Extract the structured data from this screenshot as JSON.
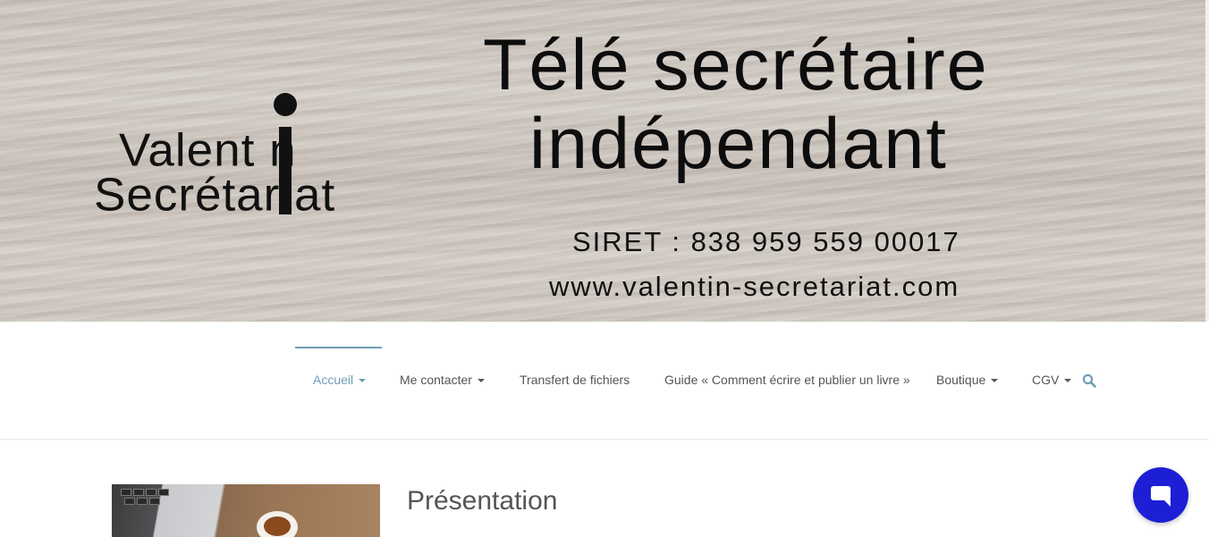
{
  "banner": {
    "logo_line1": "Valent n",
    "logo_line2": "Secrétar at",
    "headline_line1": "Télé secrétaire",
    "headline_line2": "indépendant",
    "siret": "SIRET : 838 959 559 00017",
    "website": "www.valentin-secretariat.com"
  },
  "nav": {
    "items": [
      {
        "label": "Accueil",
        "dropdown": true,
        "active": true
      },
      {
        "label": "Me contacter",
        "dropdown": true,
        "active": false
      },
      {
        "label": "Transfert de fichiers",
        "dropdown": false,
        "active": false
      },
      {
        "label": "Guide « Comment écrire et publier un livre »",
        "dropdown": false,
        "active": false
      },
      {
        "label": "Boutique",
        "dropdown": true,
        "active": false
      },
      {
        "label": "CGV",
        "dropdown": true,
        "active": false
      }
    ],
    "search_icon": "search-icon",
    "active_color": "#6e9db8"
  },
  "content": {
    "section_title": "Présentation"
  },
  "chat": {
    "icon": "chat-bubble-icon",
    "color": "#1c1fd6"
  }
}
